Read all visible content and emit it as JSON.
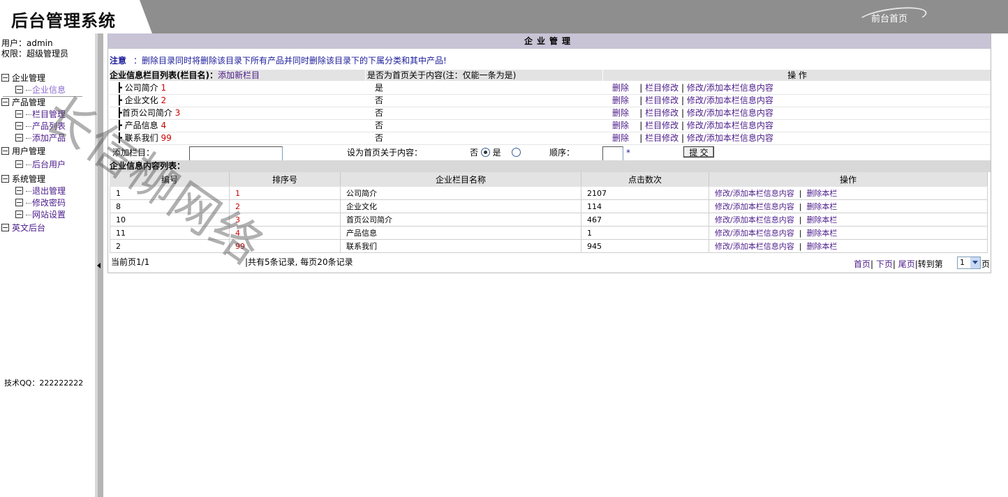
{
  "header": {
    "title": "后台管理系统",
    "home_link": "前台首页"
  },
  "sidebar": {
    "user_line": "用户：admin",
    "role_line": "权限：超级管理员",
    "tree": [
      {
        "label": "企业管理",
        "level": 0
      },
      {
        "label": "企业信息",
        "level": 1
      },
      {
        "label": "产品管理",
        "level": 0
      },
      {
        "label": "栏目管理",
        "level": 1
      },
      {
        "label": "产品列表",
        "level": 1
      },
      {
        "label": "添加产品",
        "level": 1
      },
      {
        "label": "用户管理",
        "level": 0
      },
      {
        "label": "后台用户",
        "level": 1
      },
      {
        "label": "系统管理",
        "level": 0
      },
      {
        "label": "退出管理",
        "level": 1
      },
      {
        "label": "修改密码",
        "level": 1
      },
      {
        "label": "网站设置",
        "level": 1
      },
      {
        "label": "英文后台",
        "level": 0
      }
    ],
    "tech_qq": "技术QQ：222222222"
  },
  "main": {
    "panel_title": "企业管理",
    "notice_label": "注意",
    "notice_text": "：删除目录同时将删除该目录下所有产品并同时删除该目录下的下属分类和其中产品!",
    "category_header": {
      "col1": "企业信息栏目列表(栏目名)：",
      "add_link": "添加新栏目",
      "col2": "是否为首页关于内容(注：仅能一条为是)",
      "col3": "操 作"
    },
    "categories": [
      {
        "name": "公司简介",
        "order": "1",
        "is_home": "是"
      },
      {
        "name": "企业文化",
        "order": "2",
        "is_home": "否"
      },
      {
        "name": "首页公司简介",
        "order": "3",
        "is_home": "否"
      },
      {
        "name": "产品信息",
        "order": "4",
        "is_home": "否"
      },
      {
        "name": "联系我们",
        "order": "99",
        "is_home": "否"
      }
    ],
    "ops": {
      "delete": "删除",
      "edit_col": "栏目修改",
      "edit_content": "修改/添加本栏信息内容",
      "sep": "|"
    },
    "add_form": {
      "label": "添加栏目：",
      "home_label": "设为首页关于内容：",
      "no": "否",
      "yes": "是",
      "order_label": "顺序：",
      "required": "*",
      "submit": "提 交"
    },
    "content_title": "企业信息内容列表：",
    "content_headers": [
      "编号",
      "排序号",
      "企业栏目名称",
      "点击数次",
      "操作"
    ],
    "content_rows": [
      {
        "id": "1",
        "order": "1",
        "name": "公司简介",
        "clicks": "2107"
      },
      {
        "id": "8",
        "order": "2",
        "name": "企业文化",
        "clicks": "114"
      },
      {
        "id": "10",
        "order": "3",
        "name": "首页公司简介",
        "clicks": "467"
      },
      {
        "id": "11",
        "order": "4",
        "name": "产品信息",
        "clicks": "1"
      },
      {
        "id": "2",
        "order": "99",
        "name": "联系我们",
        "clicks": "945"
      }
    ],
    "content_ops": {
      "edit": "修改/添加本栏信息内容",
      "sep": "|",
      "delete": "删除本栏"
    },
    "pager": {
      "current": "当前页1/1",
      "summary": "|共有5条记录, 每页20条记录",
      "first": "首页",
      "next": "下页",
      "last": "尾页",
      "goto": "|转到第",
      "page_value": "1",
      "page_suffix": "页"
    }
  },
  "watermark": "长信柳网络"
}
